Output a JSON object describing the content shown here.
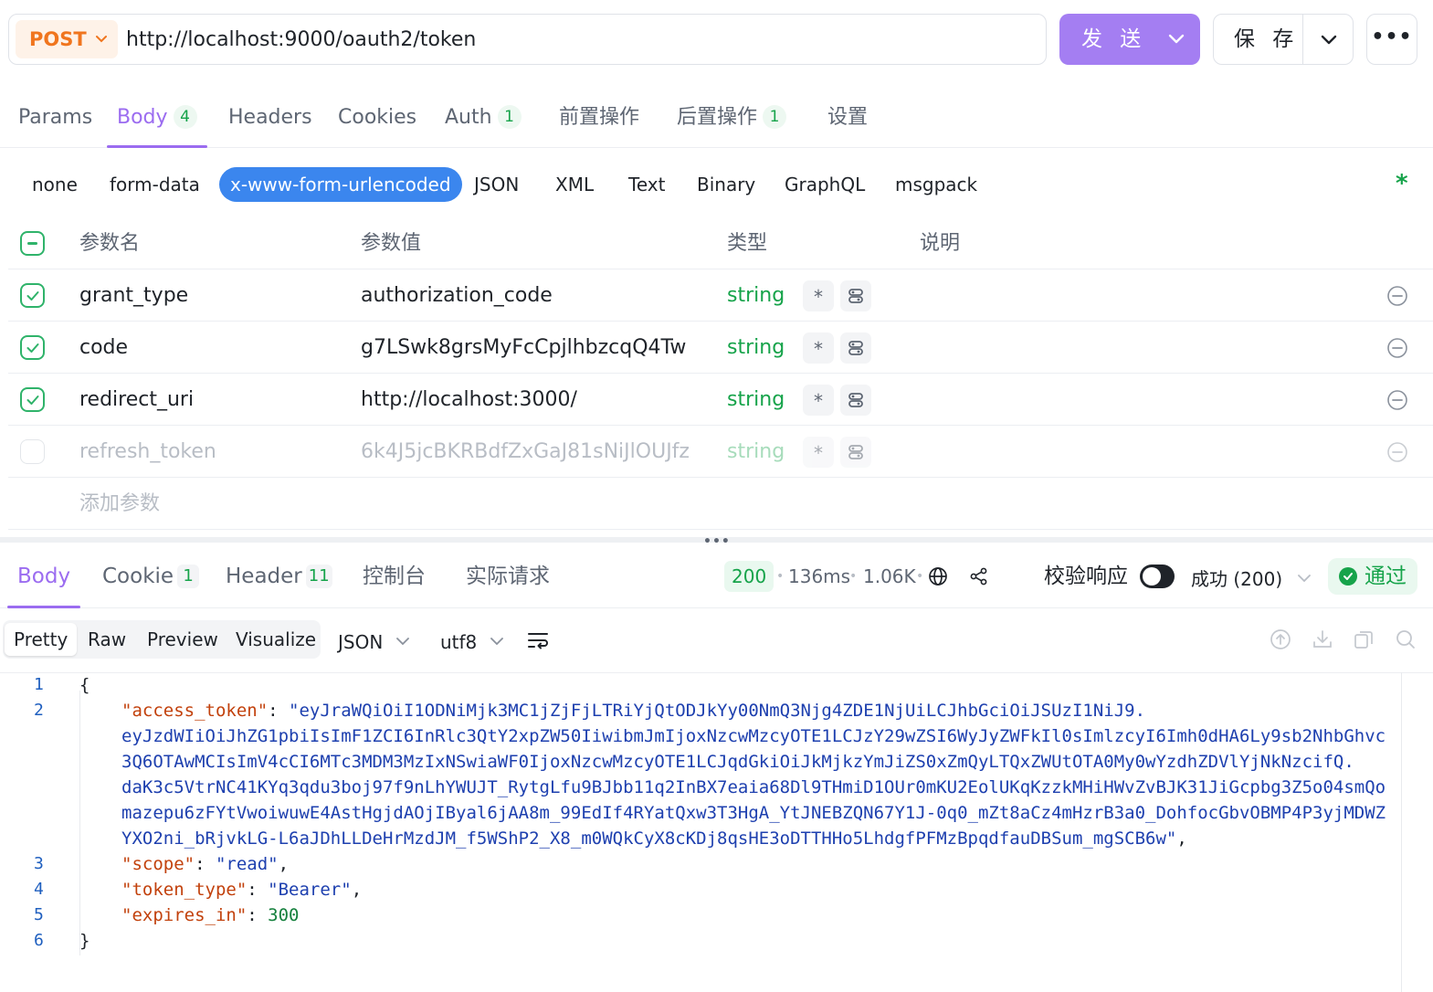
{
  "request": {
    "method": "POST",
    "url": "http://localhost:9000/oauth2/token",
    "send_label": "发 送",
    "save_label": "保 存"
  },
  "tabs": [
    {
      "label": "Params",
      "count": ""
    },
    {
      "label": "Body",
      "count": "4"
    },
    {
      "label": "Headers",
      "count": ""
    },
    {
      "label": "Cookies",
      "count": ""
    },
    {
      "label": "Auth",
      "count": "1"
    },
    {
      "label": "前置操作",
      "count": ""
    },
    {
      "label": "后置操作",
      "count": "1"
    },
    {
      "label": "设置",
      "count": ""
    }
  ],
  "body_types": [
    "none",
    "form-data",
    "x-www-form-urlencoded",
    "JSON",
    "XML",
    "Text",
    "Binary",
    "GraphQL",
    "msgpack"
  ],
  "active_body_type": "x-www-form-urlencoded",
  "params_table": {
    "headers": {
      "name": "参数名",
      "value": "参数值",
      "type": "类型",
      "desc": "说明"
    },
    "rows": [
      {
        "enabled": true,
        "name": "grant_type",
        "value": "authorization_code",
        "type": "string",
        "required": "*"
      },
      {
        "enabled": true,
        "name": "code",
        "value": "g7LSwk8grsMyFcCpjlhbzcqQ4Tw",
        "type": "string",
        "required": "*"
      },
      {
        "enabled": true,
        "name": "redirect_uri",
        "value": "http://localhost:3000/",
        "type": "string",
        "required": "*"
      },
      {
        "enabled": false,
        "name": "refresh_token",
        "value": "6k4J5jcBKRBdfZxGaJ81sNiJlOUJfz",
        "type": "string",
        "required": "*"
      }
    ],
    "add_placeholder": "添加参数"
  },
  "response": {
    "tabs": [
      {
        "label": "Body",
        "count": ""
      },
      {
        "label": "Cookie",
        "count": "1"
      },
      {
        "label": "Header",
        "count": "11"
      },
      {
        "label": "控制台",
        "count": ""
      },
      {
        "label": "实际请求",
        "count": ""
      }
    ],
    "status_code": "200",
    "time": "136ms",
    "size": "1.06K",
    "validate_label": "校验响应",
    "validate_on": true,
    "success_label": "成功 (200)",
    "pass_label": "通过",
    "view_modes": [
      "Pretty",
      "Raw",
      "Preview",
      "Visualize"
    ],
    "active_view": "Pretty",
    "format": "JSON",
    "encoding": "utf8",
    "line_numbers": [
      "1",
      "2",
      "3",
      "4",
      "5",
      "6"
    ],
    "code": {
      "open": "{",
      "close": "}",
      "access_token_key": "\"access_token\"",
      "access_token_lines": [
        "\"eyJraWQiOiI1ODNiMjk3MC1jZjFjLTRiYjQtODJkYy00NmQ3Njg4ZDE1NjUiLCJhbGciOiJSUzI1NiJ9.",
        "eyJzdWIiOiJhZG1pbiIsImF1ZCI6InRlc3QtY2xpZW50IiwibmJmIjoxNzcwMzcyOTE1LCJzY29wZSI6WyJyZWFkIl0sImlzcyI6Imh0dHA6Ly9sb2NhbGhvc",
        "3Q6OTAwMCIsImV4cCI6MTc3MDM3MzIxNSwiaWF0IjoxNzcwMzcyOTE1LCJqdGkiOiJkMjkzYmJiZS0xZmQyLTQxZWUtOTA0My0wYzdhZDVlYjNkNzcifQ.",
        "daK3c5VtrNC41KYq3qdu3boj97f9nLhYWUJT_RytgLfu9BJbb11q2InBX7eaia68Dl9THmiD1OUr0mKU2EolUKqKzzkMHiHWvZvBJK31JiGcpbg3Z5o04smQo",
        "mazepu6zFYtVwoiwuwE4AstHgjdAOjIByal6jAA8m_99EdIf4RYatQxw3T3HgA_YtJNEBZQN67Y1J-0q0_mZt8aCz4mHzrB3a0_DohfocGbvOBMP4P3yjMDWZ",
        "YXO2ni_bRjvkLG-L6aJDhLLDeHrMzdJM_f5WShP2_X8_m0WQkCyX8cKDj8qsHE3oDTTHHo5LhdgfPFMzBpqdfauDBSum_mgSCB6w\""
      ],
      "scope_key": "\"scope\"",
      "scope_val": "\"read\"",
      "token_type_key": "\"token_type\"",
      "token_type_val": "\"Bearer\"",
      "expires_in_key": "\"expires_in\"",
      "expires_in_val": "300"
    }
  },
  "colors": {
    "accent": "#9b6cf0",
    "send": "#a47ef2",
    "method": "#f0751e",
    "success": "#16a34a",
    "body_type_active": "#3b86ee"
  }
}
